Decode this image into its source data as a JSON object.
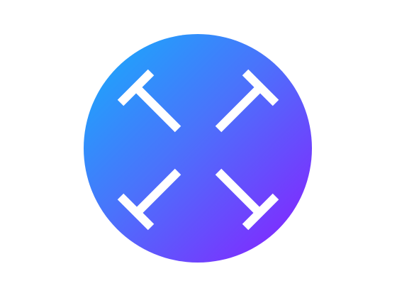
{
  "icon": {
    "name": "expand-arrows-icon",
    "colors": {
      "background": "#ffffff",
      "gradient_start": "#14b0fb",
      "gradient_mid": "#4a73fb",
      "gradient_end": "#8b1cff",
      "glyph": "#ffffff"
    }
  }
}
